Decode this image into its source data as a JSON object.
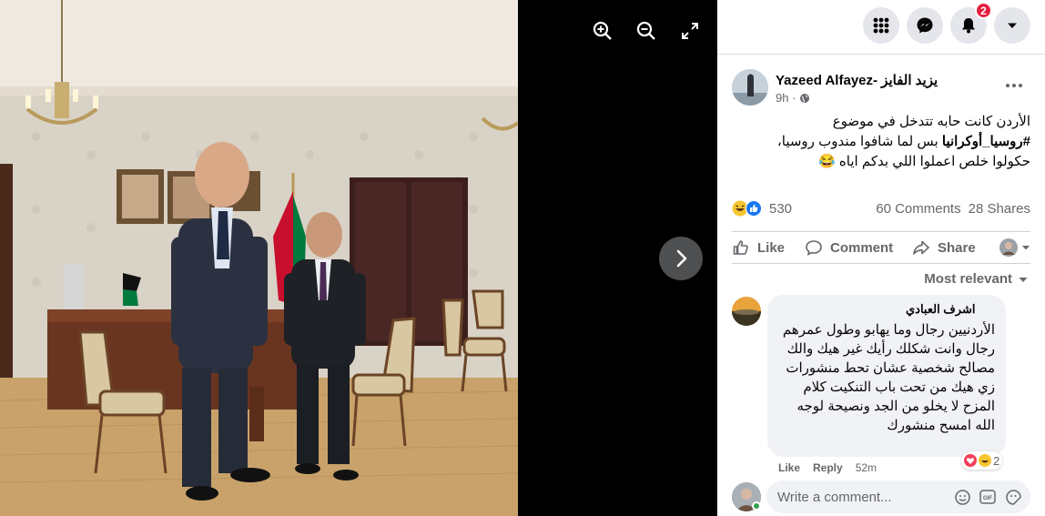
{
  "viewer": {
    "zoom_in_icon": "zoom-in-icon",
    "zoom_out_icon": "zoom-out-icon",
    "fullscreen_icon": "fullscreen-icon",
    "next_icon": "chevron-right-icon"
  },
  "topbar": {
    "menu_icon": "grid-menu-icon",
    "messenger_icon": "messenger-icon",
    "notifications_icon": "bell-icon",
    "notifications_count": "2",
    "account_icon": "caret-down-icon"
  },
  "post": {
    "author": "Yazeed Alfayez- يزيد الفايز",
    "time": "9h ·",
    "audience_icon": "globe-icon",
    "text_line1": "الأردن كانت حابه تتدخل في موضوع",
    "hashtag": "#روسيا_أوكرانيا",
    "text_line2_rest": " بس لما شافوا مندوب روسيا،",
    "text_line3": "حكولوا خلص اعملوا اللي بدكم اياه",
    "text_emoji": "😂",
    "reactions_count": "530",
    "comments": "60 Comments",
    "shares": "28 Shares",
    "reaction_icons": [
      "haha-icon",
      "like-icon"
    ]
  },
  "actions": {
    "like": "Like",
    "comment": "Comment",
    "share": "Share"
  },
  "sort": {
    "label": "Most relevant"
  },
  "comment": {
    "author": "اشرف العبادي",
    "text": "الأردنيين رجال وما يهابو وطول عمرهم رجال وانت شكلك رأيك غير هيك والك مصالح شخصية عشان تحط منشورات زي هيك من تحت باب التنكيت كلام المزح لا يخلو من الجد ونصيحة لوجه الله امسح منشورك",
    "like": "Like",
    "reply": "Reply",
    "time": "52m",
    "reaction_count": "2"
  },
  "composer": {
    "placeholder": "Write a comment...",
    "icons": [
      "emoji-icon",
      "gif-icon",
      "sticker-icon"
    ]
  },
  "colors": {
    "panel_bg": "#ffffff",
    "secondary_text": "#65676b",
    "badge_red": "#e41e3f",
    "bubble_bg": "#f0f2f5",
    "online_green": "#31a24c"
  }
}
